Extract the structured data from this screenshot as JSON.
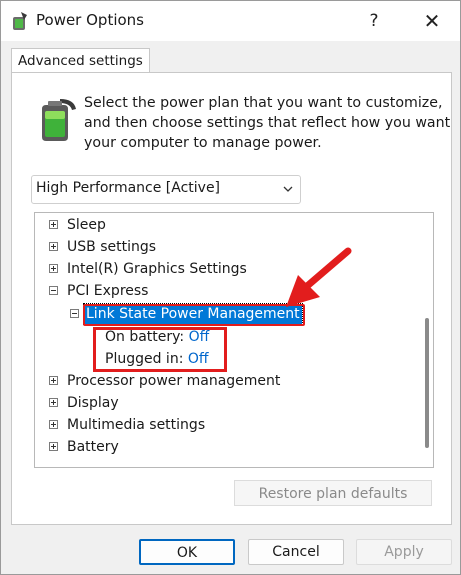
{
  "window": {
    "title": "Power Options",
    "help_label": "?",
    "close_label": "✕"
  },
  "tab": {
    "label": "Advanced settings"
  },
  "description": [
    "Select the power plan that you want to customize,",
    "and then choose settings that reflect how you want",
    "your computer to manage power."
  ],
  "plan": {
    "selected": "High Performance [Active]"
  },
  "tree": {
    "items": [
      {
        "label": "Sleep",
        "state": "collapsed"
      },
      {
        "label": "USB settings",
        "state": "collapsed"
      },
      {
        "label": "Intel(R) Graphics Settings",
        "state": "collapsed"
      },
      {
        "label": "PCI Express",
        "state": "expanded"
      },
      {
        "label": "Link State Power Management",
        "state": "expanded",
        "selected": true
      },
      {
        "label": "On battery:",
        "value": "Off"
      },
      {
        "label": "Plugged in:",
        "value": "Off"
      },
      {
        "label": "Processor power management",
        "state": "collapsed"
      },
      {
        "label": "Display",
        "state": "collapsed"
      },
      {
        "label": "Multimedia settings",
        "state": "collapsed"
      },
      {
        "label": "Battery",
        "state": "collapsed"
      }
    ]
  },
  "buttons": {
    "restore": "Restore plan defaults",
    "ok": "OK",
    "cancel": "Cancel",
    "apply": "Apply"
  },
  "colors": {
    "selection": "#0078d7",
    "annotation": "#e21d1d",
    "link": "#0066cc"
  }
}
